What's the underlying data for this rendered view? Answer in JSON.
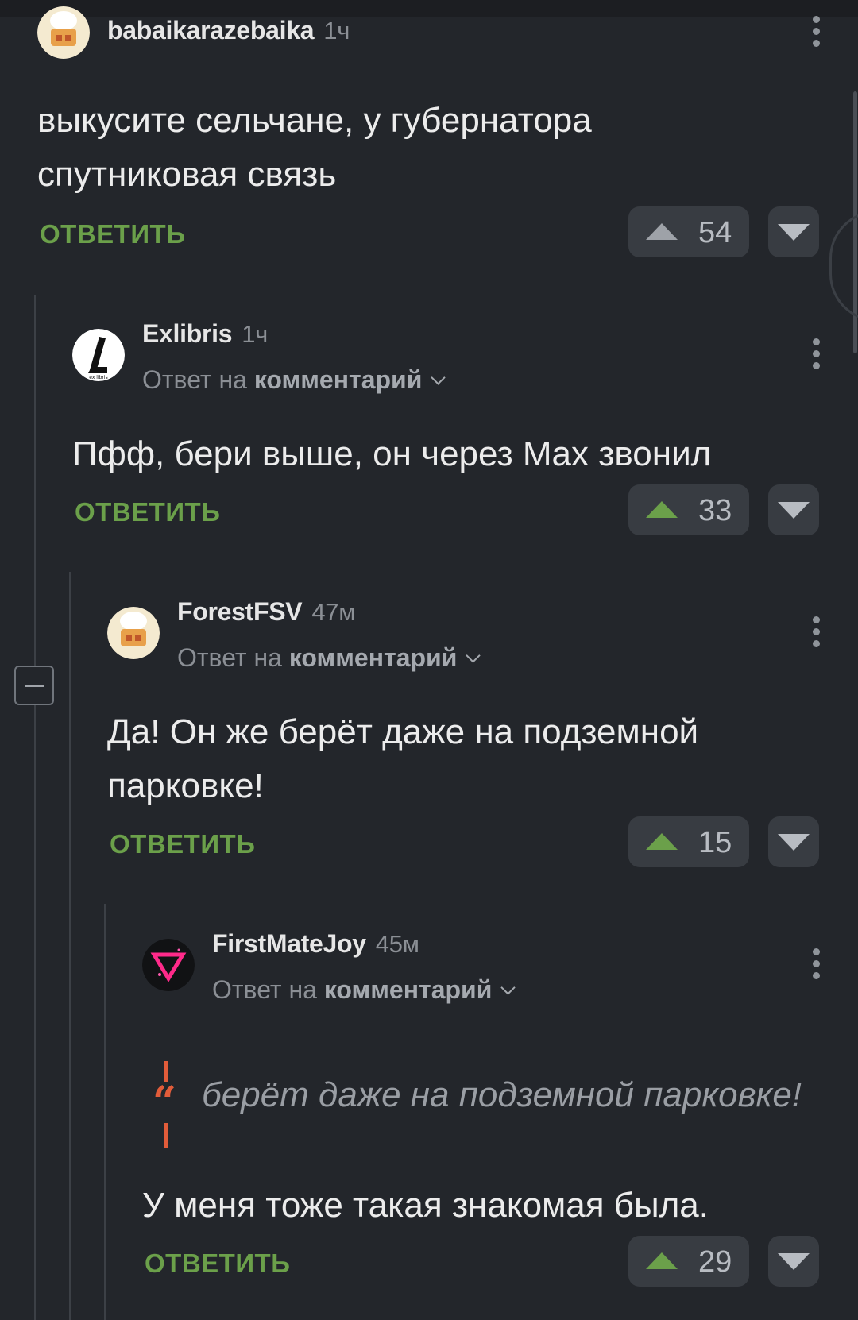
{
  "comments": [
    {
      "user": "babaikarazebaika",
      "time": "1ч",
      "text_lines": [
        "выкусите сельчане, у губернатора",
        "спутниковая связь"
      ],
      "reply_label": "ОТВЕТИТЬ",
      "score": "54",
      "avatar_icon": "chef-hat-avatar-icon"
    },
    {
      "user": "Exlibris",
      "time": "1ч",
      "reply_prefix": "Ответ на",
      "reply_target": "комментарий",
      "text_lines": [
        "Пфф, бери выше, он через Max звонил"
      ],
      "reply_label": "ОТВЕТИТЬ",
      "score": "33",
      "avatar_icon": "ex-libris-logo-avatar-icon"
    },
    {
      "user": "ForestFSV",
      "time": "47м",
      "reply_prefix": "Ответ на",
      "reply_target": "комментарий",
      "text_lines": [
        "Да! Он же берёт даже на подземной",
        "парковке!"
      ],
      "reply_label": "ОТВЕТИТЬ",
      "score": "15",
      "avatar_icon": "chef-hat-avatar-icon"
    },
    {
      "user": "FirstMateJoy",
      "time": "45м",
      "reply_prefix": "Ответ на",
      "reply_target": "комментарий",
      "quote": "берёт даже на подземной парковке!",
      "text_lines": [
        "У меня тоже такая знакомая была."
      ],
      "reply_label": "ОТВЕТИТЬ",
      "score": "29",
      "avatar_icon": "pink-triangle-avatar-icon"
    }
  ],
  "colors": {
    "background": "#23262b",
    "reply_link": "#6ba04a",
    "upvote_active": "#6ba04a",
    "quote_accent": "#e25c3a"
  }
}
